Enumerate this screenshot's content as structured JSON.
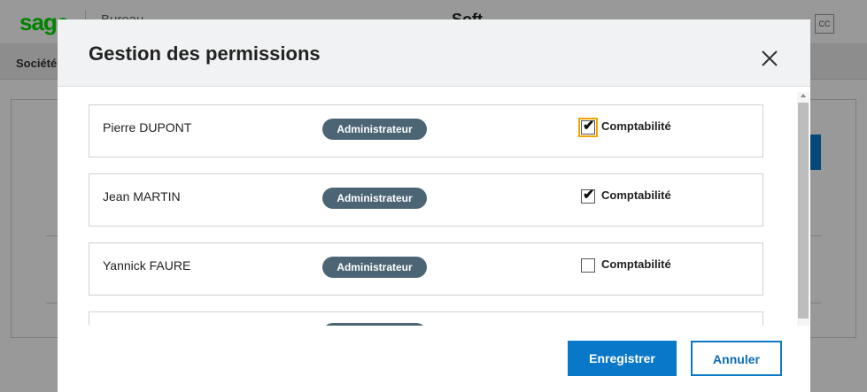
{
  "app": {
    "logo": "sage",
    "header_sub": "Bureau",
    "header_title": "Soft",
    "header_cc": "CC",
    "tab_label": "Société"
  },
  "modal": {
    "title": "Gestion des permissions",
    "close_icon": "close-icon",
    "rows": [
      {
        "name": "Pierre DUPONT",
        "role": "Administrateur",
        "permission_label": "Comptabilité",
        "checked": true,
        "focused": true
      },
      {
        "name": "Jean MARTIN",
        "role": "Administrateur",
        "permission_label": "Comptabilité",
        "checked": true,
        "focused": false
      },
      {
        "name": "Yannick FAURE",
        "role": "Administrateur",
        "permission_label": "Comptabilité",
        "checked": false,
        "focused": false
      },
      {
        "name": "",
        "role": "",
        "permission_label": "",
        "checked": false,
        "focused": false
      }
    ],
    "footer": {
      "save_label": "Enregistrer",
      "cancel_label": "Annuler"
    }
  },
  "colors": {
    "primary": "#0a78c8",
    "badge": "#4c6574",
    "focus": "#f0a500",
    "brand": "#00dc00"
  }
}
